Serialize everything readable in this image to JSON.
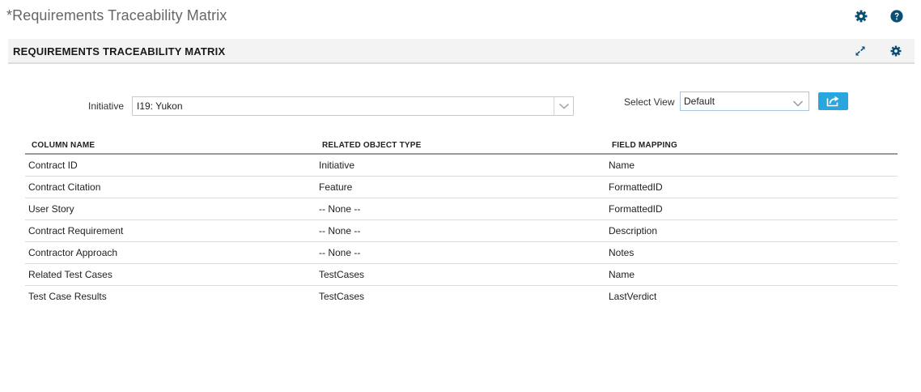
{
  "page": {
    "title": "*Requirements Traceability Matrix"
  },
  "panel": {
    "title": "REQUIREMENTS TRACEABILITY MATRIX"
  },
  "controls": {
    "initiative_label": "Initiative",
    "initiative_value": "I19: Yukon",
    "view_label": "Select View",
    "view_value": "Default"
  },
  "table": {
    "headers": [
      "COLUMN NAME",
      "RELATED OBJECT TYPE",
      "FIELD MAPPING"
    ],
    "rows": [
      [
        "Contract ID",
        "Initiative",
        "Name"
      ],
      [
        "Contract Citation",
        "Feature",
        "FormattedID"
      ],
      [
        "User Story",
        "-- None --",
        "FormattedID"
      ],
      [
        "Contract Requirement",
        "-- None --",
        "Description"
      ],
      [
        "Contractor Approach",
        "-- None --",
        "Notes"
      ],
      [
        "Related Test Cases",
        "TestCases",
        "Name"
      ],
      [
        "Test Case Results",
        "TestCases",
        "LastVerdict"
      ]
    ]
  },
  "icons": {
    "top_settings": "gear-icon",
    "top_help": "help-icon",
    "panel_expand": "expand-icon",
    "panel_settings": "gear-icon",
    "export": "share-export-icon"
  },
  "colors": {
    "icon_accent": "#0a4f73",
    "export_button": "#2aa6de",
    "panel_header_bg": "#f3f3f3"
  }
}
